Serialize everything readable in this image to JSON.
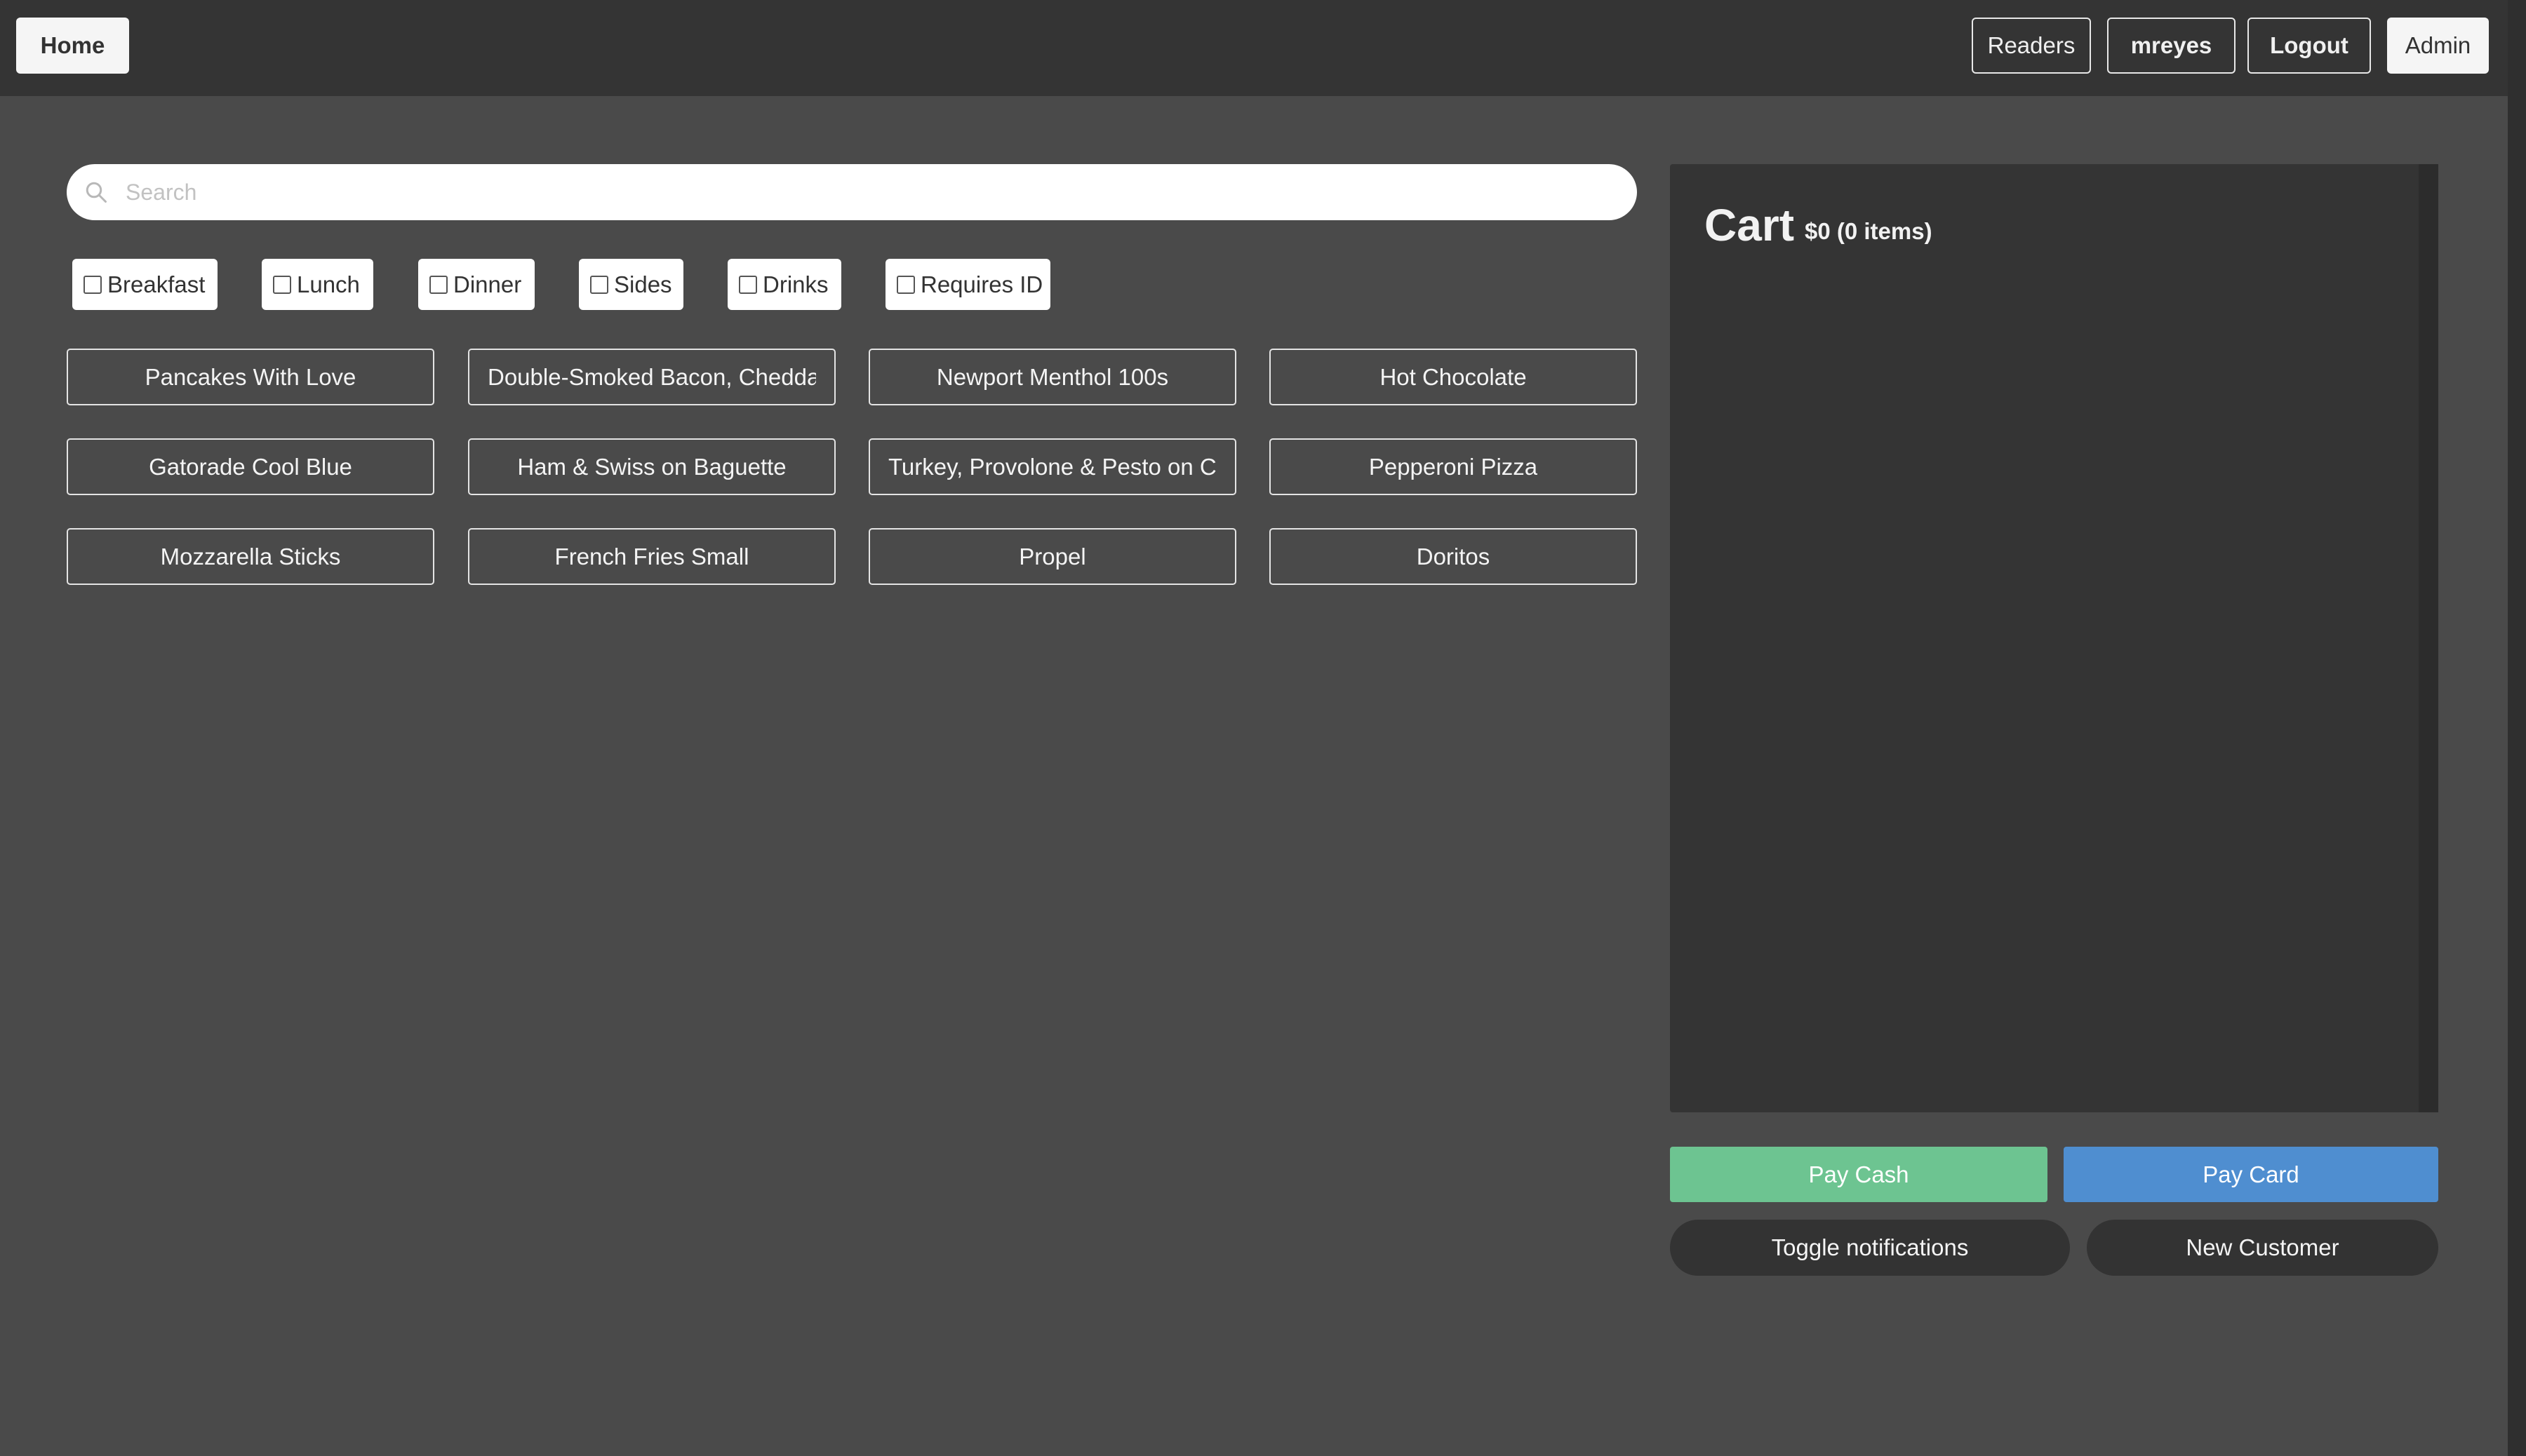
{
  "nav": {
    "home": "Home",
    "readers": "Readers",
    "user": "mreyes",
    "logout": "Logout",
    "admin": "Admin"
  },
  "search": {
    "placeholder": "Search",
    "value": "",
    "icon": "search-icon"
  },
  "filters": [
    "Breakfast",
    "Lunch",
    "Dinner",
    "Sides",
    "Drinks",
    "Requires ID"
  ],
  "items": [
    "Pancakes With Love",
    "Double-Smoked Bacon, Cheddar",
    "Newport Menthol 100s",
    "Hot Chocolate",
    "Gatorade Cool Blue",
    "Ham & Swiss on Baguette",
    "Turkey, Provolone & Pesto on C",
    "Pepperoni Pizza",
    "Mozzarella Sticks",
    "French Fries Small",
    "Propel",
    "Doritos"
  ],
  "cart": {
    "title": "Cart",
    "summary": "$0 (0 items)"
  },
  "actions": {
    "pay_cash": "Pay Cash",
    "pay_card": "Pay Card",
    "toggle_notifications": "Toggle notifications",
    "new_customer": "New Customer"
  },
  "colors": {
    "background": "#4a4a4a",
    "topbar": "#343434",
    "pay_cash": "#6dc491",
    "pay_card": "#4f8ed0"
  }
}
